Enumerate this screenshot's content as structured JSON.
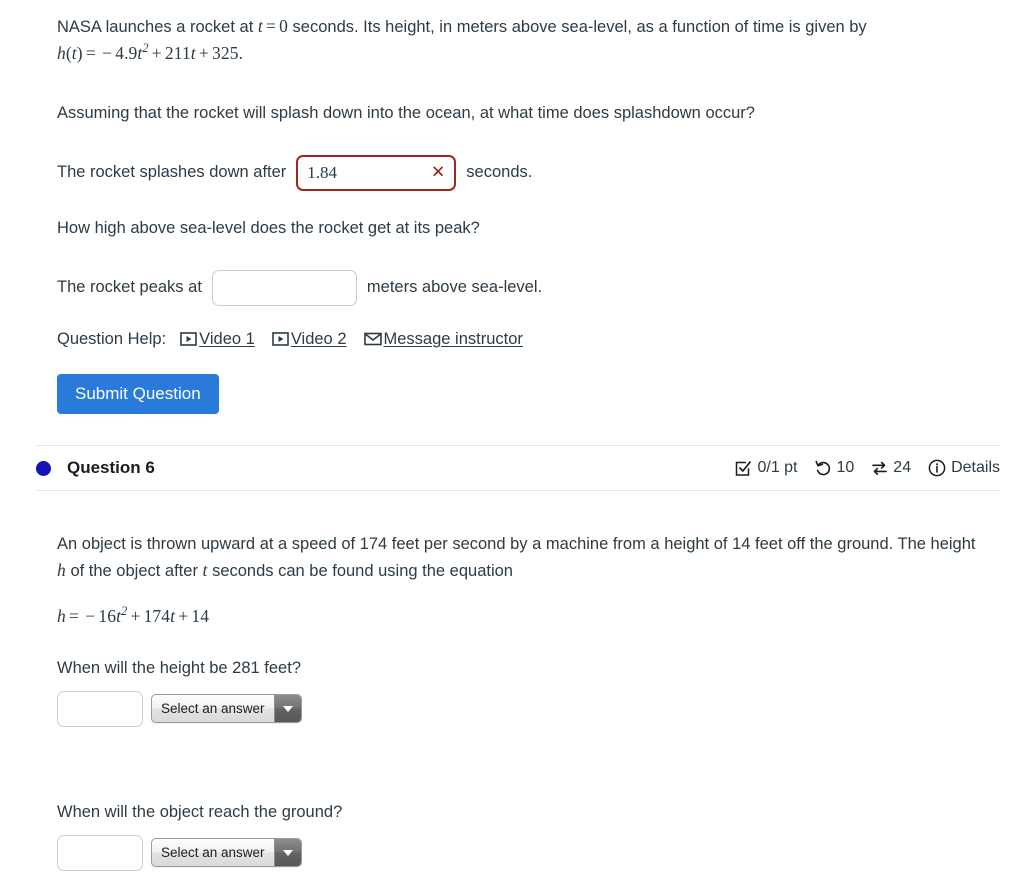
{
  "question5": {
    "paragraph_1_prefix": "NASA launches a rocket at ",
    "paragraph_1_math_t": "t = 0",
    "paragraph_1_mid": " seconds. Its height, in meters above sea-level, as a function of time is given by ",
    "paragraph_1_math_h": "h(t) = − 4.9t² + 211t + 325.",
    "prompt_splashdown": "Assuming that the rocket will splash down into the ocean, at what time does splashdown occur?",
    "splashdown_label_before": "The rocket splashes down after",
    "splashdown_value": "1.84",
    "splashdown_status_icon": "x-mark-icon",
    "splashdown_label_after": "seconds.",
    "prompt_peak": "How high above sea-level does the rocket get at its peak?",
    "peak_label_before": "The rocket peaks at",
    "peak_value": "",
    "peak_label_after": "meters above sea-level.",
    "help_label": "Question Help:",
    "help_links": [
      {
        "label": "Video 1",
        "icon": "video-play-icon"
      },
      {
        "label": "Video 2",
        "icon": "video-play-icon"
      },
      {
        "label": "Message instructor",
        "icon": "envelope-icon"
      }
    ],
    "submit_label": "Submit Question"
  },
  "question6": {
    "bullet_icon": "unanswered-dot-icon",
    "title": "Question 6",
    "stats": [
      {
        "icon": "checkbox-checked-icon",
        "value": "0/1 pt"
      },
      {
        "icon": "undo-arrow-icon",
        "value": "10"
      },
      {
        "icon": "swap-arrows-icon",
        "value": "24"
      },
      {
        "icon": "info-circle-icon",
        "value": "Details"
      }
    ],
    "paragraph_prefix": "An object is thrown upward at a speed of 174 feet per second by a machine from a height of 14 feet off the ground. The height ",
    "paragraph_var_h": "h",
    "paragraph_mid": " of the object after ",
    "paragraph_var_t": "t",
    "paragraph_suffix": " seconds can be found using the equation",
    "equation": "h = − 16t² + 174t + 14",
    "sub_question_1": "When will the height be 281 feet?",
    "answer_1_value": "",
    "select_1_value": "Select an answer",
    "sub_question_2": "When will the object reach the ground?",
    "answer_2_value": "",
    "select_2_value": "Select an answer"
  },
  "colors": {
    "accent_blue": "#2a7ad9",
    "bullet_blue": "#1414b8",
    "error_red": "#9c1f16",
    "text": "#2d3b45",
    "divider": "#e6e7e8"
  }
}
